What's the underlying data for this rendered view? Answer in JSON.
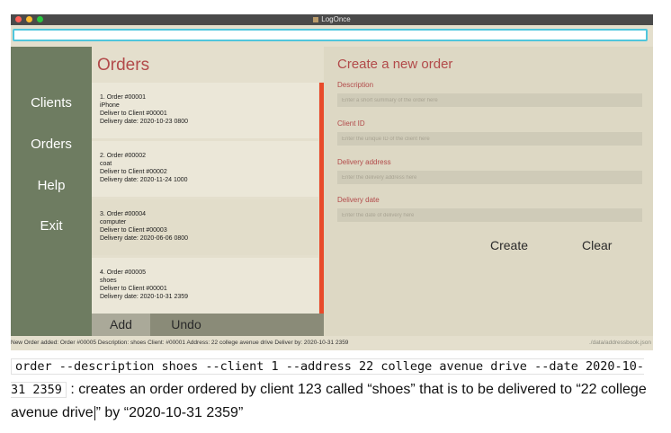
{
  "window": {
    "title": "LogOnce",
    "traffic_lights": [
      "#ff5f57",
      "#febc2e",
      "#28c840"
    ]
  },
  "command_box": {
    "value": ""
  },
  "sidebar": {
    "items": [
      {
        "label": "Clients"
      },
      {
        "label": "Orders"
      },
      {
        "label": "Help"
      },
      {
        "label": "Exit"
      }
    ]
  },
  "orders_panel": {
    "title": "Orders",
    "cards": [
      {
        "heading": "1.  Order #00001",
        "item": "iPhone",
        "client": "Deliver to Client #00001",
        "date": "Delivery date: 2020-10-23 0800"
      },
      {
        "heading": "2.  Order #00002",
        "item": "coat",
        "client": "Deliver to Client #00002",
        "date": "Delivery date: 2020-11-24 1000"
      },
      {
        "heading": "3.  Order #00004",
        "item": "computer",
        "client": "Deliver to Client #00003",
        "date": "Delivery date: 2020-06-06 0800"
      },
      {
        "heading": "4.  Order #00005",
        "item": "shoes",
        "client": "Deliver to Client #00001",
        "date": "Delivery date: 2020-10-31 2359"
      }
    ],
    "add_label": "Add",
    "undo_label": "Undo"
  },
  "form": {
    "title": "Create a new order",
    "fields": [
      {
        "label": "Description",
        "placeholder": "Enter a short summary of the order here"
      },
      {
        "label": "Client ID",
        "placeholder": "Enter the unique ID of the client here"
      },
      {
        "label": "Delivery address",
        "placeholder": "Enter the delivery address here"
      },
      {
        "label": "Delivery date",
        "placeholder": "Enter the date of delivery here"
      }
    ],
    "create_label": "Create",
    "clear_label": "Clear"
  },
  "status": {
    "message": "New Order added: Order #00005  Description: shoes Client: #00001 Address: 22 college avenue drive Deliver by: 2020-10-31 2359",
    "path": "./data/addressbook.json"
  },
  "caption": {
    "command": "order --description shoes --client 1 --address 22 college avenue drive --date 2020-10-31 2359",
    "text_1": ": creates an order ordered by client 123 called “shoes” that is to be delivered to “22 college avenue drive",
    "text_2": "” by “2020-10-31 2359”"
  }
}
